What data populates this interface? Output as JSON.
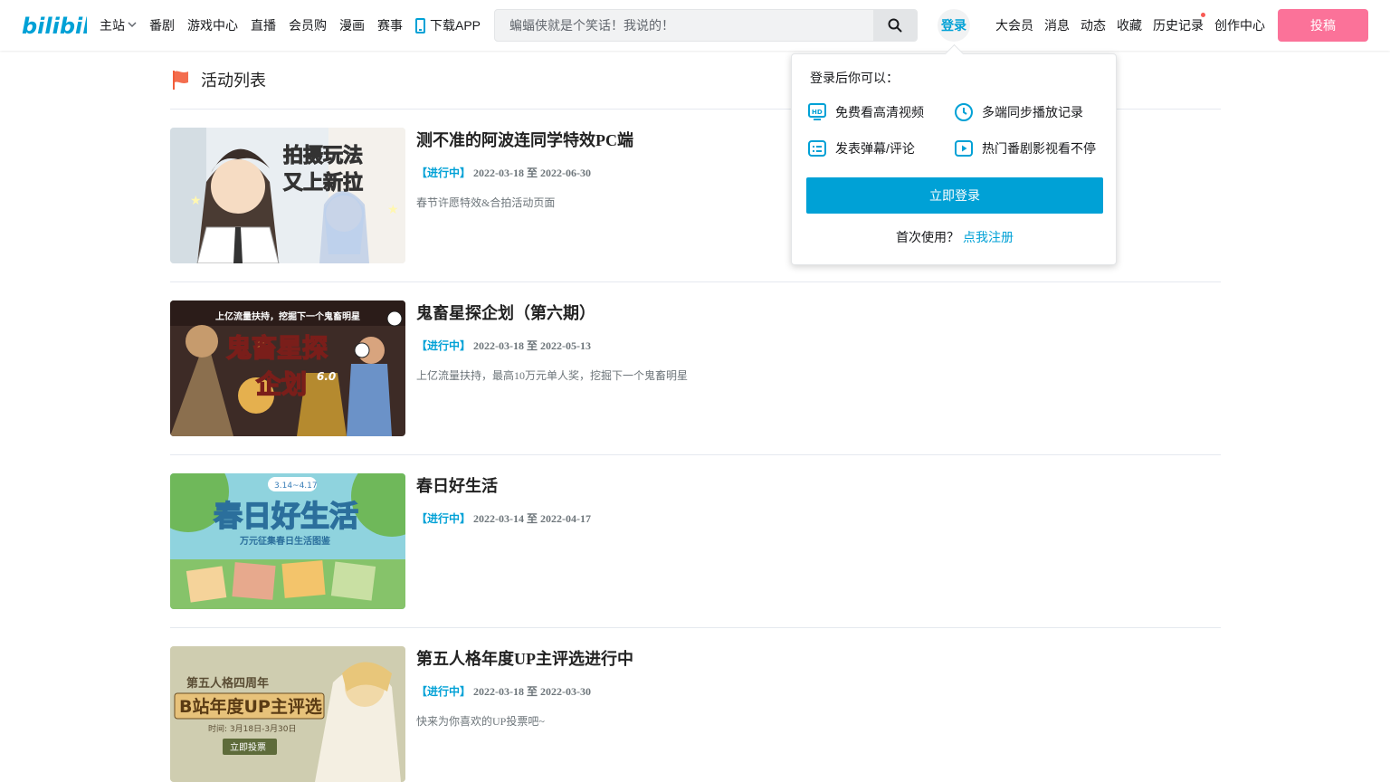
{
  "header": {
    "logo_text": "bilibili",
    "nav": [
      {
        "label": "主站",
        "has_dropdown": true
      },
      {
        "label": "番剧"
      },
      {
        "label": "游戏中心"
      },
      {
        "label": "直播"
      },
      {
        "label": "会员购"
      },
      {
        "label": "漫画"
      },
      {
        "label": "赛事"
      },
      {
        "label": "下载APP",
        "icon": "phone-icon"
      }
    ],
    "search_placeholder": "蝙蝠侠就是个笑话！我说的！",
    "login_label": "登录",
    "right_nav": [
      {
        "label": "大会员"
      },
      {
        "label": "消息"
      },
      {
        "label": "动态"
      },
      {
        "label": "收藏"
      },
      {
        "label": "历史记录",
        "red_dot": true
      },
      {
        "label": "创作中心"
      }
    ],
    "upload_label": "投稿"
  },
  "section": {
    "title": "活动列表"
  },
  "activities": [
    {
      "title": "测不准的阿波连同学特效PC端",
      "status": "【进行中】",
      "dates": "2022-03-18 至 2022-06-30",
      "desc": "春节许愿特效&合拍活动页面",
      "thumb_text": [
        "拍摄玩法",
        "又上新拉"
      ]
    },
    {
      "title": "鬼畜星探企划（第六期）",
      "status": "【进行中】",
      "dates": "2022-03-18 至 2022-05-13",
      "desc": "上亿流量扶持，最高10万元单人奖，挖掘下一个鬼畜明星",
      "thumb_text": [
        "上亿流量扶持，挖掘下一个鬼畜明星",
        "鬼畜星探",
        "企划",
        "6.0"
      ]
    },
    {
      "title": "春日好生活",
      "status": "【进行中】",
      "dates": "2022-03-14 至 2022-04-17",
      "desc": "",
      "thumb_text": [
        "3.14~4.17",
        "春日好生活",
        "万元征集春日生活图鉴"
      ]
    },
    {
      "title": "第五人格年度UP主评选进行中",
      "status": "【进行中】",
      "dates": "2022-03-18 至 2022-03-30",
      "desc": "快来为你喜欢的UP投票吧~",
      "thumb_text": [
        "第五人格四周年",
        "B站年度UP主评选",
        "时间: 3月18日-3月30日",
        "立即投票"
      ]
    }
  ],
  "popover": {
    "heading": "登录后你可以：",
    "features": [
      {
        "label": "免费看高清视频",
        "icon": "hd-icon"
      },
      {
        "label": "多端同步播放记录",
        "icon": "clock-icon"
      },
      {
        "label": "发表弹幕/评论",
        "icon": "danmaku-icon"
      },
      {
        "label": "热门番剧影视看不停",
        "icon": "play-icon"
      }
    ],
    "login_button": "立即登录",
    "footer_text": "首次使用？",
    "register_link": "点我注册"
  },
  "colors": {
    "accent_blue": "#00a1d6",
    "upload_pink": "#fb7299",
    "flag_orange": "#f25d3b"
  }
}
